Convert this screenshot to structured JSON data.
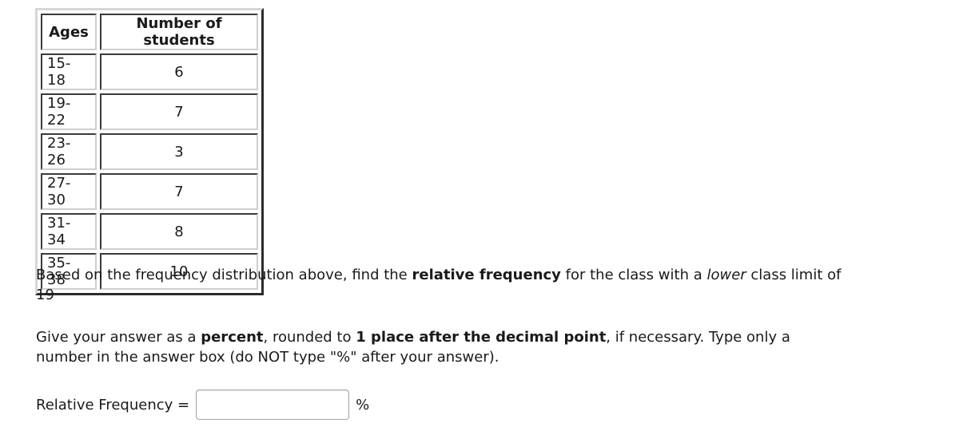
{
  "table": {
    "headers": [
      "Ages",
      "Number of students"
    ],
    "rows": [
      {
        "ages": "15-18",
        "count": "6"
      },
      {
        "ages": "19-22",
        "count": "7"
      },
      {
        "ages": "23-26",
        "count": "3"
      },
      {
        "ages": "27-30",
        "count": "7"
      },
      {
        "ages": "31-34",
        "count": "8"
      },
      {
        "ages": "35-38",
        "count": "10"
      }
    ]
  },
  "question": {
    "p1_a": "Based on the frequency distribution above, find the ",
    "p1_bold": "relative frequency",
    "p1_b": " for the class with a ",
    "p1_italic": "lower",
    "p1_c": " class limit of 19",
    "p2_a": "Give your answer as a ",
    "p2_bold1": "percent",
    "p2_b": ", rounded to ",
    "p2_bold2": "1 place after the decimal point",
    "p2_c": ", if necessary. Type only a number in the answer box (do NOT type \"%\" after your answer)."
  },
  "answer": {
    "label": "Relative Frequency =",
    "value": "",
    "placeholder": "",
    "unit": "%"
  }
}
